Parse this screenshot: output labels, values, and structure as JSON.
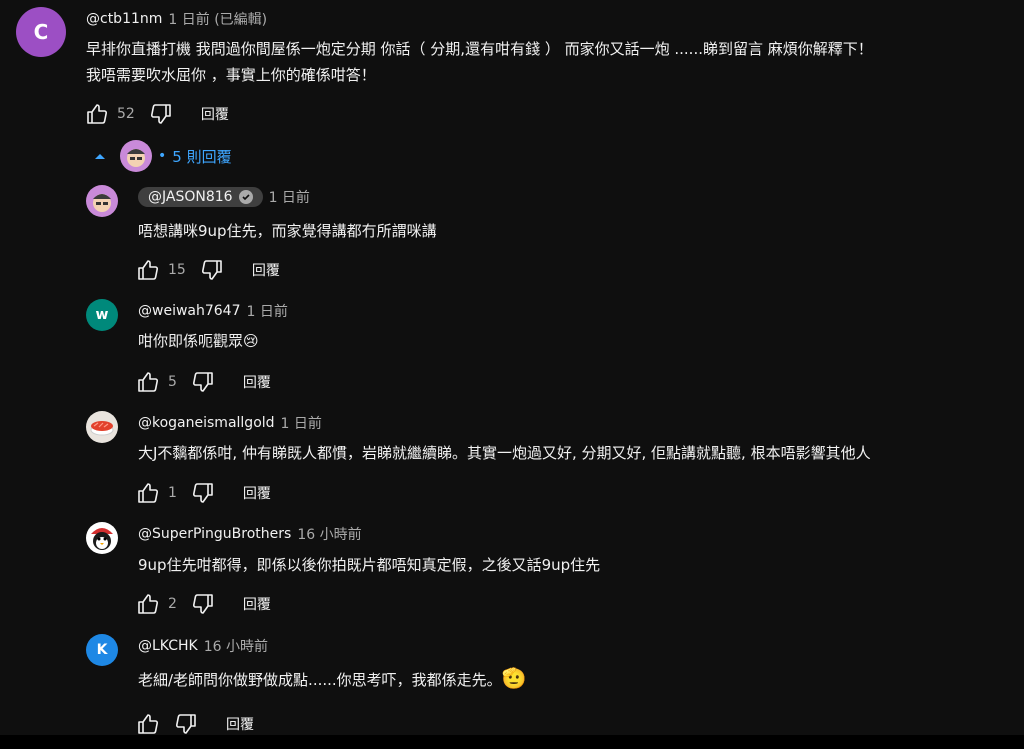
{
  "comment": {
    "avatar_letter": "C",
    "avatar_color": "#9c4fc4",
    "author": "@ctb11nm",
    "time": "1 日前 (已編輯)",
    "text_line1": "早排你直播打機 我問過你間屋係一炮定分期 你話（ 分期,還有咁有錢 ） 而家你又話一炮 ......睇到留言 麻煩你解釋下！",
    "text_line2": " 我唔需要吹水屈你 ，事實上你的確係咁答！",
    "likes": "52",
    "reply_label": "回覆"
  },
  "replies_toggle": {
    "label": "5 則回覆",
    "accent_color": "#3ea6ff"
  },
  "replies": [
    {
      "author": "@JASON816",
      "time": "1 日前",
      "text": "唔想講咪9up住先，而家覺得講都冇所謂咪講",
      "likes": "15",
      "reply_label": "回覆",
      "avatar_icon": "cartoon-cap-avatar"
    },
    {
      "author": "@weiwah7647",
      "time": "1 日前",
      "text": "咁你即係呃觀眾",
      "emoji": "😢",
      "likes": "5",
      "reply_label": "回覆",
      "avatar_letter": "w",
      "avatar_color": "#00897b"
    },
    {
      "author": "@koganeismallgold",
      "time": "1 日前",
      "text": "大J不黐都係咁, 仲有睇既人都慣，岩睇就繼續睇。其實一炮過又好, 分期又好, 佢點講就點聽, 根本唔影響其他人",
      "likes": "1",
      "reply_label": "回覆",
      "avatar_icon": "sushi-avatar"
    },
    {
      "author": "@SuperPinguBrothers",
      "time": "16 小時前",
      "text": "9up住先咁都得，即係以後你拍既片都唔知真定假，之後又話9up住先",
      "likes": "2",
      "reply_label": "回覆",
      "avatar_icon": "penguin-avatar"
    },
    {
      "author": "@LKCHK",
      "time": "16 小時前",
      "text": "老細/老師問你做野做成點......你思考吓，我都係走先。",
      "emoji": "🫡",
      "likes": "",
      "reply_label": "回覆",
      "avatar_letter": "K",
      "avatar_color": "#1e88e5"
    }
  ]
}
